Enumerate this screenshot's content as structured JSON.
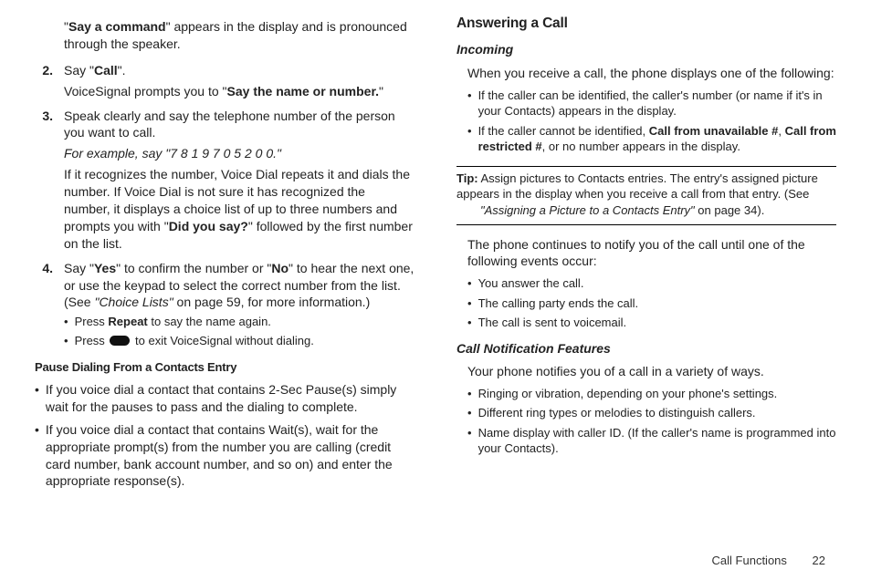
{
  "left": {
    "intro_1a": "\"",
    "intro_1b": "Say a command",
    "intro_1c": "\" appears in the display and is pronounced through the speaker.",
    "step2_num": "2.",
    "step2_a": "Say \"",
    "step2_b": "Call",
    "step2_c": "\".",
    "step2_p2a": "VoiceSignal prompts you to \"",
    "step2_p2b": "Say the name or number.",
    "step2_p2c": "\"",
    "step3_num": "3.",
    "step3_p1": "Speak clearly and say the telephone number of the person you want to call.",
    "step3_ex": "For example, say \"7 8 1 9 7 0 5 2 0 0.\"",
    "step3_p2a": "If it recognizes the number, Voice Dial repeats it and dials the number. If Voice Dial is not sure it has recognized the number, it displays a choice list of up to three numbers and prompts you with \"",
    "step3_p2b": "Did you say?",
    "step3_p2c": "\" followed by the first number on the list.",
    "step4_num": "4.",
    "step4_a": "Say \"",
    "step4_b": "Yes",
    "step4_c": "\" to confirm the number or \"",
    "step4_d": "No",
    "step4_e": "\" to hear the next one, or use the keypad to select the correct number from the list. (See ",
    "step4_f": "\"Choice Lists\"",
    "step4_g": " on page 59, for more information.)",
    "sub1_a": "Press ",
    "sub1_b": "Repeat",
    "sub1_c": " to say the name again.",
    "sub2_a": "Press ",
    "sub2_c": " to exit VoiceSignal without dialing.",
    "h_pause": "Pause Dialing From a Contacts Entry",
    "pause_b1": "If you voice dial a contact that contains 2-Sec Pause(s) simply wait for the pauses to pass and the dialing to complete.",
    "pause_b2": "If you voice dial a contact that contains Wait(s), wait for the appropriate prompt(s) from the number you are calling (credit card number, bank account number, and so on) and enter the appropriate response(s)."
  },
  "right": {
    "h_answer": "Answering a Call",
    "h_incoming": "Incoming",
    "inc_p1": "When you receive a call, the phone displays one of the following:",
    "inc_b1": "If the caller can be identified, the caller's number (or name if it's in your Contacts) appears in the display.",
    "inc_b2a": "If the caller cannot be identified, ",
    "inc_b2b": "Call from unavailable #",
    "inc_b2c": ", ",
    "inc_b2d": "Call from restricted #",
    "inc_b2e": ", or no number appears in the display.",
    "tip_label": "Tip:",
    "tip_1": " Assign pictures to Contacts entries. The entry's assigned picture appears in the display when you receive a call from that entry. (See ",
    "tip_2": "\"Assigning a Picture to a Contacts Entry\"",
    "tip_3": " on page 34).",
    "cont_p1": "The phone continues to notify you of the call until one of the following events occur:",
    "cont_b1": "You answer the call.",
    "cont_b2": "The calling party ends the call.",
    "cont_b3": "The call is sent to voicemail.",
    "h_cnf": "Call Notification Features",
    "cnf_p1": "Your phone notifies you of a call in a variety of ways.",
    "cnf_b1": "Ringing or vibration, depending on your phone's settings.",
    "cnf_b2": "Different ring types or melodies to distinguish callers.",
    "cnf_b3": "Name display with caller ID. (If the caller's name is programmed into your Contacts)."
  },
  "footer": {
    "section": "Call Functions",
    "page": "22"
  }
}
